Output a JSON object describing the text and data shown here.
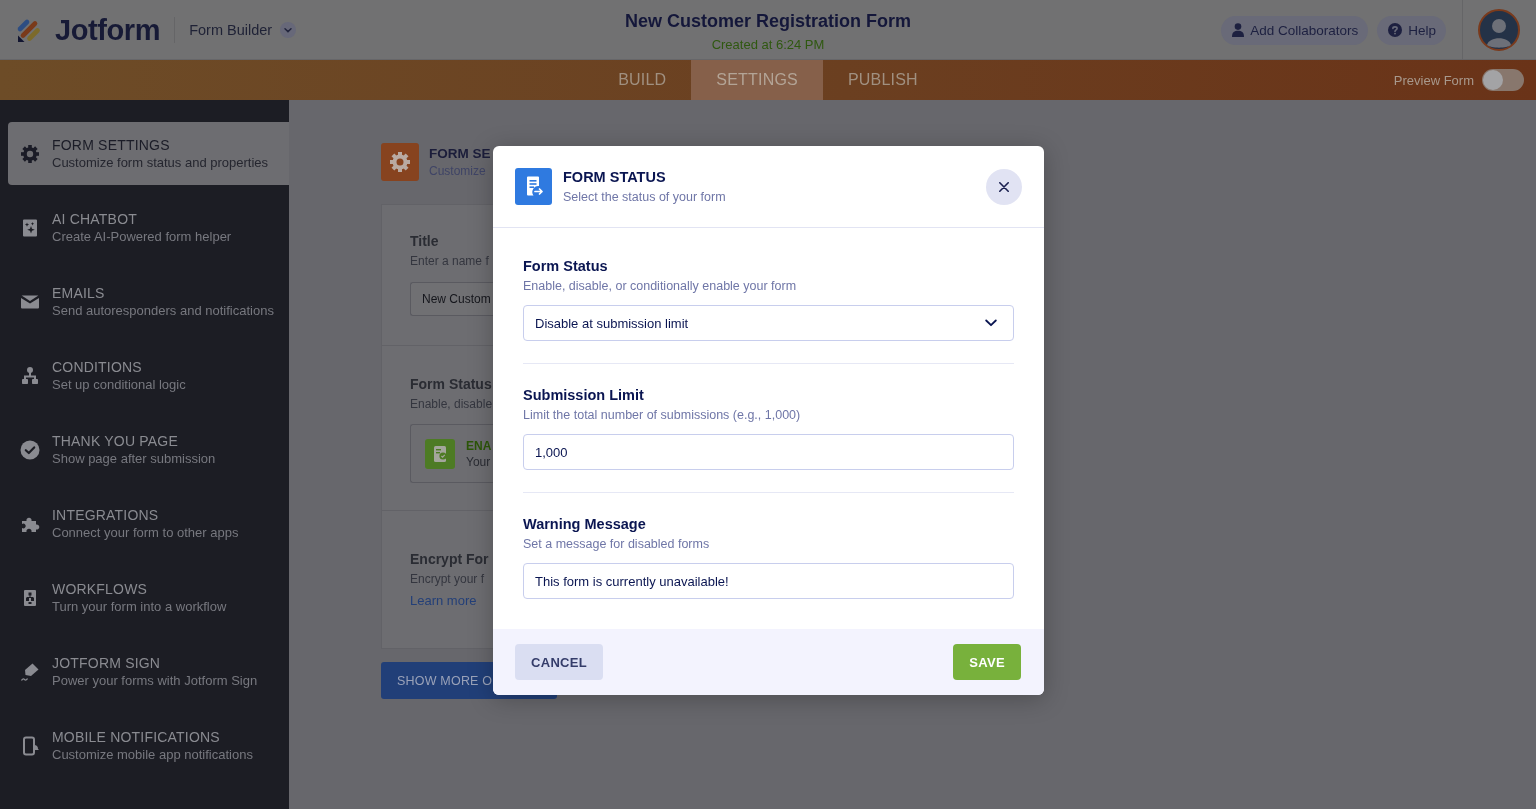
{
  "header": {
    "logo": "Jotform",
    "product_menu": "Form Builder",
    "form_title": "New Customer Registration Form",
    "created": "Created at 6:24 PM",
    "buttons": [
      {
        "label": "Add Collaborators",
        "kind": "collaborators"
      },
      {
        "label": "Help",
        "kind": "help"
      }
    ]
  },
  "nav": {
    "tabs": [
      {
        "label": "BUILD",
        "selected": false
      },
      {
        "label": "SETTINGS",
        "selected": true
      },
      {
        "label": "PUBLISH",
        "selected": false
      }
    ],
    "preview": {
      "label": "Preview Form",
      "on": false
    }
  },
  "sidebar": {
    "items": [
      {
        "title": "FORM SETTINGS",
        "subtitle": "Customize form status and properties",
        "selected": true
      },
      {
        "title": "AI CHATBOT",
        "subtitle": "Create AI-Powered form helper",
        "selected": false
      },
      {
        "title": "EMAILS",
        "subtitle": "Send autoresponders and notifications",
        "selected": false
      },
      {
        "title": "CONDITIONS",
        "subtitle": "Set up conditional logic",
        "selected": false
      },
      {
        "title": "THANK YOU PAGE",
        "subtitle": "Show page after submission",
        "selected": false
      },
      {
        "title": "INTEGRATIONS",
        "subtitle": "Connect your form to other apps",
        "selected": false
      },
      {
        "title": "WORKFLOWS",
        "subtitle": "Turn your form into a workflow",
        "selected": false
      },
      {
        "title": "JOTFORM SIGN",
        "subtitle": "Power your forms with Jotform Sign",
        "selected": false
      },
      {
        "title": "MOBILE NOTIFICATIONS",
        "subtitle": "Customize mobile app notifications",
        "selected": false
      }
    ]
  },
  "settings_panel": {
    "title": "FORM SE",
    "subtitle": "Customize",
    "sections": [
      {
        "kind": "input",
        "title": "Title",
        "description": "Enter a name f",
        "value": "New Custom"
      },
      {
        "kind": "status",
        "title": "Form Status",
        "description": "Enable, disable",
        "status": "ENA",
        "status_text": "Your"
      },
      {
        "kind": "link",
        "title": "Encrypt For",
        "description": "Encrypt your f",
        "link": "Learn more"
      }
    ],
    "button": "SHOW MORE O"
  },
  "modal": {
    "title": "FORM STATUS",
    "subtitle": "Select the status of your form",
    "fields": [
      {
        "kind": "select",
        "label": "Form Status",
        "description": "Enable, disable, or conditionally enable your form",
        "value": "Disable at submission limit"
      },
      {
        "kind": "input",
        "label": "Submission Limit",
        "description": "Limit the total number of submissions (e.g., 1,000)",
        "value": "1,000"
      },
      {
        "kind": "input",
        "label": "Warning Message",
        "description": "Set a message for disabled forms",
        "value": "This form is currently unavailable!"
      }
    ],
    "buttons": [
      {
        "label": "CANCEL",
        "kind": "cancel"
      },
      {
        "label": "SAVE",
        "kind": "save"
      }
    ]
  }
}
